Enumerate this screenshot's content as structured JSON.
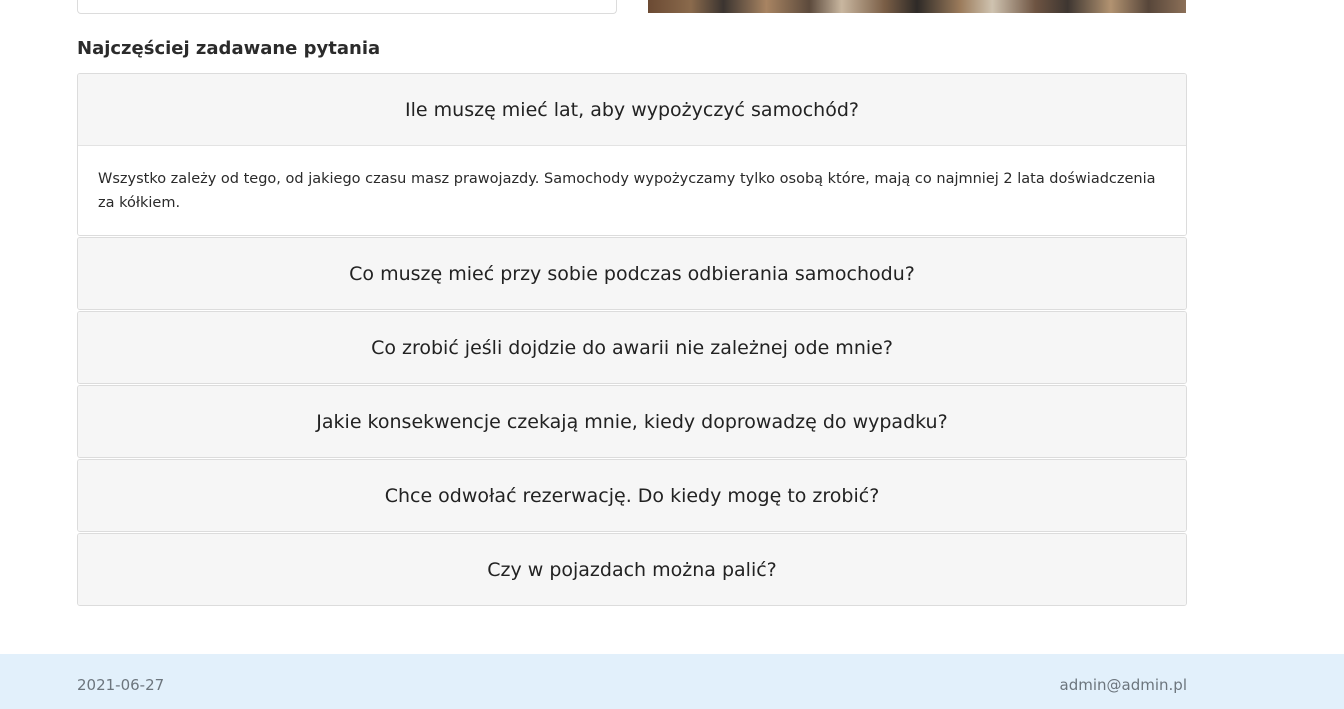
{
  "faq": {
    "title": "Najczęściej zadawane pytania",
    "items": [
      {
        "question": "Ile muszę mieć lat, aby wypożyczyć samochód?",
        "answer": "Wszystko zależy od tego, od jakiego czasu masz prawojazdy. Samochody wypożyczamy tylko osobą które, mają co najmniej 2 lata doświadczenia za kółkiem.",
        "expanded": true
      },
      {
        "question": "Co muszę mieć przy sobie podczas odbierania samochodu?",
        "expanded": false
      },
      {
        "question": "Co zrobić jeśli dojdzie do awarii nie zależnej ode mnie?",
        "expanded": false
      },
      {
        "question": "Jakie konsekwencje czekają mnie, kiedy doprowadzę do wypadku?",
        "expanded": false
      },
      {
        "question": "Chce odwołać rezerwację. Do kiedy mogę to zrobić?",
        "expanded": false
      },
      {
        "question": "Czy w pojazdach można palić?",
        "expanded": false
      }
    ]
  },
  "footer": {
    "date": "2021-06-27",
    "email": "admin@admin.pl",
    "background_color": "#e2f0fb"
  }
}
